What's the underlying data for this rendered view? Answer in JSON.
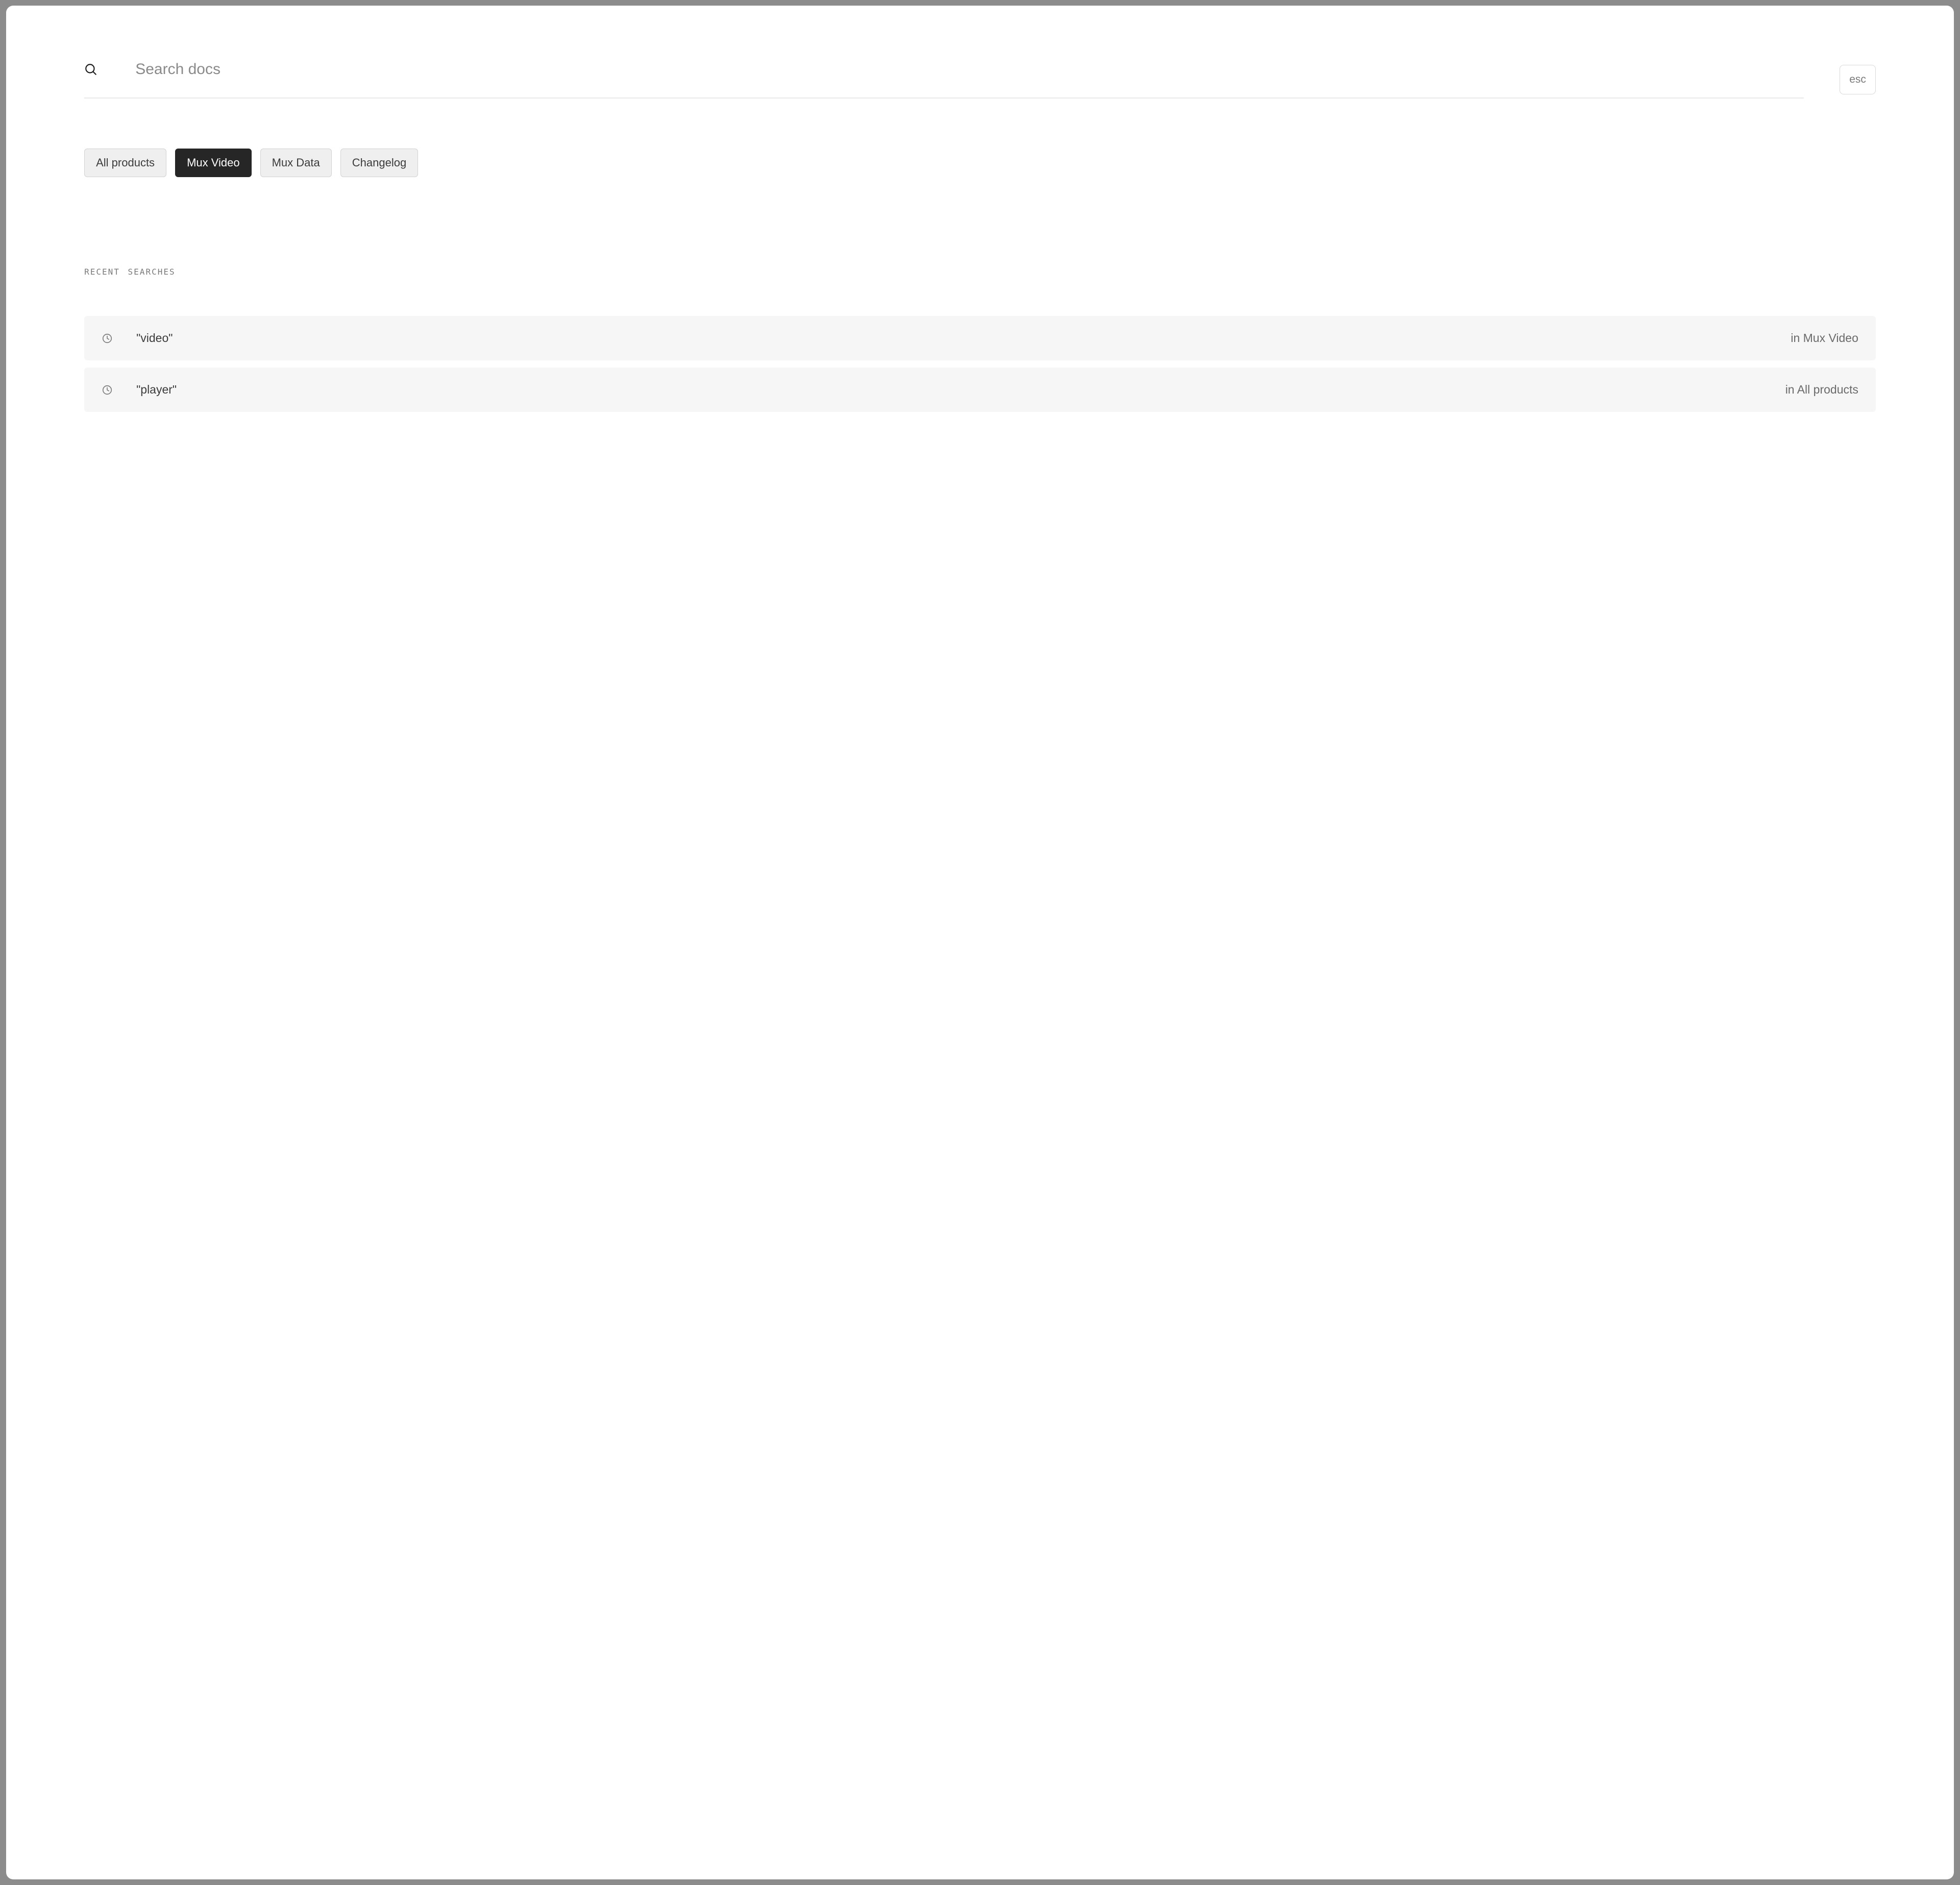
{
  "search": {
    "placeholder": "Search docs",
    "value": "",
    "esc_label": "esc"
  },
  "filters": [
    {
      "label": "All products",
      "active": false
    },
    {
      "label": "Mux Video",
      "active": true
    },
    {
      "label": "Mux Data",
      "active": false
    },
    {
      "label": "Changelog",
      "active": false
    }
  ],
  "recent": {
    "title": "Recent Searches",
    "items": [
      {
        "query": "\"video\"",
        "scope": "in Mux Video"
      },
      {
        "query": "\"player\"",
        "scope": "in All products"
      }
    ]
  },
  "icons": {
    "search": "search-icon",
    "clock": "clock-icon"
  }
}
